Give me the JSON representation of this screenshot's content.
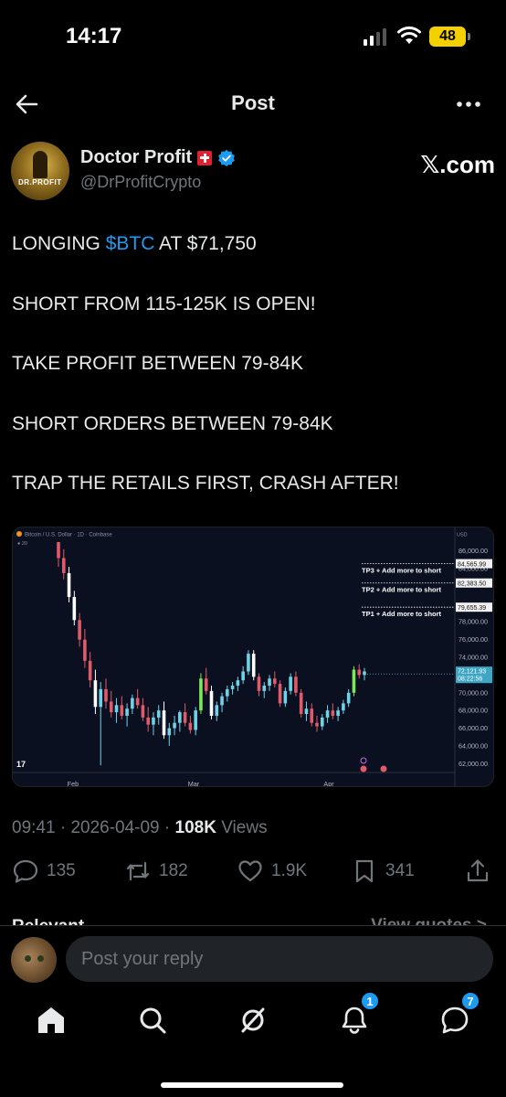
{
  "status_bar": {
    "time": "14:17",
    "battery": "48"
  },
  "header": {
    "title": "Post"
  },
  "author": {
    "display_name": "Doctor Profit",
    "handle": "@DrProfitCrypto",
    "avatar_text": "DR.PROFIT",
    "source": "𝕏.com"
  },
  "tweet": {
    "line1_pre": "LONGING ",
    "line1_cashtag": "$BTC",
    "line1_post": " AT $71,750",
    "line2": "SHORT FROM 115-125K IS OPEN!",
    "line3": "TAKE PROFIT BETWEEN 79-84K",
    "line4": "SHORT ORDERS BETWEEN 79-84K",
    "line5": "TRAP THE RETAILS FIRST, CRASH AFTER!"
  },
  "chart_data": {
    "type": "candlestick",
    "title": "Bitcoin / U.S. Dollar · 1D · Coinbase",
    "currency_label": "USD",
    "y_ticks": [
      "86,000.00",
      "84,000.00",
      "78,000.00",
      "76,000.00",
      "74,000.00",
      "70,000.00",
      "68,000.00",
      "66,000.00",
      "64,000.00",
      "62,000.00"
    ],
    "x_ticks": [
      "Feb",
      "Mar",
      "Apr"
    ],
    "ylim": [
      61000,
      87000
    ],
    "levels": [
      {
        "label": "TP3 + Add more to short",
        "value": 84565.99,
        "value_label": "84,565.99"
      },
      {
        "label": "TP2 + Add more to short",
        "value": 82383.5,
        "value_label": "82,383.50"
      },
      {
        "label": "TP1 + Add more to short",
        "value": 79655.39,
        "value_label": "79,655.39"
      }
    ],
    "last_price": {
      "value_label": "72,121.93",
      "countdown": "08:22:56",
      "value": 72121.93
    },
    "candles": [
      [
        87000,
        88000,
        84200,
        85200
      ],
      [
        85200,
        86200,
        82800,
        83500
      ],
      [
        83500,
        84200,
        80200,
        80800
      ],
      [
        80800,
        81500,
        77600,
        78200
      ],
      [
        78200,
        79000,
        75200,
        76000
      ],
      [
        76000,
        77200,
        72800,
        73600
      ],
      [
        73600,
        74600,
        70600,
        71400
      ],
      [
        71400,
        72600,
        67600,
        68400
      ],
      [
        68400,
        71200,
        61800,
        70400
      ],
      [
        70400,
        71600,
        68200,
        69000
      ],
      [
        69000,
        70200,
        67200,
        67800
      ],
      [
        67800,
        69400,
        66600,
        68600
      ],
      [
        68600,
        69600,
        67000,
        67400
      ],
      [
        67400,
        68800,
        66200,
        68200
      ],
      [
        68200,
        69800,
        67600,
        69400
      ],
      [
        69400,
        70400,
        68200,
        68600
      ],
      [
        68600,
        69400,
        66800,
        67200
      ],
      [
        67200,
        68400,
        65600,
        66400
      ],
      [
        66400,
        67800,
        65200,
        67200
      ],
      [
        67200,
        68600,
        66400,
        68000
      ],
      [
        68000,
        69000,
        64800,
        65200
      ],
      [
        65200,
        66600,
        64000,
        66000
      ],
      [
        66000,
        67400,
        65200,
        66600
      ],
      [
        66600,
        68000,
        65600,
        67800
      ],
      [
        67800,
        68800,
        66200,
        66600
      ],
      [
        66600,
        67400,
        65400,
        65800
      ],
      [
        65800,
        68400,
        65200,
        68000
      ],
      [
        68000,
        72200,
        67600,
        71600
      ],
      [
        71600,
        72800,
        69800,
        70200
      ],
      [
        70200,
        70800,
        67000,
        67400
      ],
      [
        67400,
        69000,
        66800,
        68600
      ],
      [
        68600,
        70000,
        67800,
        69600
      ],
      [
        69600,
        70800,
        69000,
        70400
      ],
      [
        70400,
        71200,
        69800,
        70800
      ],
      [
        70800,
        71800,
        70200,
        71400
      ],
      [
        71400,
        73000,
        71000,
        72400
      ],
      [
        72400,
        74800,
        72000,
        74400
      ],
      [
        74400,
        74800,
        71400,
        71800
      ],
      [
        71800,
        72200,
        69600,
        70200
      ],
      [
        70200,
        71200,
        69400,
        70800
      ],
      [
        70800,
        72000,
        70200,
        71600
      ],
      [
        71600,
        72400,
        70600,
        71000
      ],
      [
        71000,
        71400,
        68400,
        68800
      ],
      [
        68800,
        70600,
        68400,
        70200
      ],
      [
        70200,
        72200,
        69800,
        71800
      ],
      [
        71800,
        72400,
        69600,
        70000
      ],
      [
        70000,
        70400,
        67200,
        67600
      ],
      [
        67600,
        69000,
        66800,
        68200
      ],
      [
        68200,
        68800,
        66200,
        66600
      ],
      [
        66600,
        67400,
        65600,
        66200
      ],
      [
        66200,
        67600,
        65800,
        67200
      ],
      [
        67200,
        68600,
        66600,
        68000
      ],
      [
        68000,
        68800,
        67000,
        67400
      ],
      [
        67400,
        68400,
        66800,
        68000
      ],
      [
        68000,
        69200,
        67600,
        68800
      ],
      [
        68800,
        70400,
        68400,
        70000
      ],
      [
        70000,
        73000,
        69600,
        72600
      ],
      [
        72600,
        73200,
        71600,
        72000
      ],
      [
        72000,
        72800,
        71400,
        72400
      ]
    ]
  },
  "meta": {
    "time": "09:41",
    "separator": " · ",
    "date": "2026-04-09",
    "views_count": "108K",
    "views_label": " Views"
  },
  "actions": {
    "replies": "135",
    "reposts": "182",
    "likes": "1.9K",
    "bookmarks": "341"
  },
  "relevant": {
    "label": "Relevant ⌄",
    "view_quotes": "View quotes >"
  },
  "reply": {
    "placeholder": "Post your reply"
  },
  "tabs": {
    "notifications_badge": "1",
    "messages_badge": "7"
  }
}
